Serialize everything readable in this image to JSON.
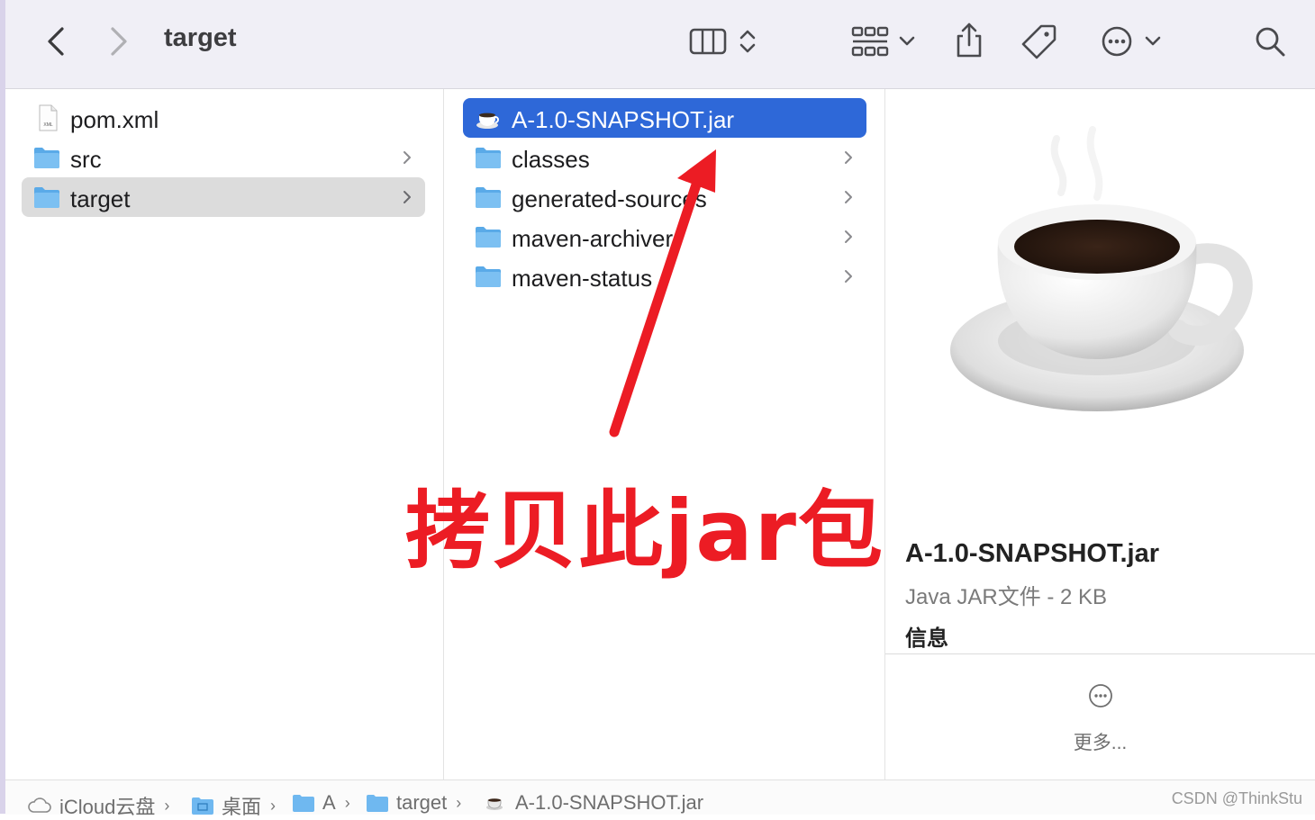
{
  "window": {
    "title": "target"
  },
  "columns": {
    "col1": [
      {
        "label": "pom.xml",
        "icon": "xml-file-icon",
        "folder": false,
        "selected": "none"
      },
      {
        "label": "src",
        "icon": "folder-icon",
        "folder": true,
        "selected": "none"
      },
      {
        "label": "target",
        "icon": "folder-icon",
        "folder": true,
        "selected": "inactive"
      }
    ],
    "col2": [
      {
        "label": "A-1.0-SNAPSHOT.jar",
        "icon": "jar-file-icon",
        "folder": false,
        "selected": "active"
      },
      {
        "label": "classes",
        "icon": "folder-icon",
        "folder": true,
        "selected": "none"
      },
      {
        "label": "generated-sources",
        "icon": "folder-icon",
        "folder": true,
        "selected": "none"
      },
      {
        "label": "maven-archiver",
        "icon": "folder-icon",
        "folder": true,
        "selected": "none"
      },
      {
        "label": "maven-status",
        "icon": "folder-icon",
        "folder": true,
        "selected": "none"
      }
    ]
  },
  "annotation": {
    "text": "拷贝此jar包",
    "color": "#ec1c24"
  },
  "preview": {
    "name": "A-1.0-SNAPSHOT.jar",
    "kind": "Java JAR文件 - 2 KB",
    "info_heading": "信息",
    "more_label": "更多..."
  },
  "pathbar": {
    "crumbs": [
      {
        "label": "iCloud云盘",
        "icon": "cloud-icon"
      },
      {
        "label": "桌面",
        "icon": "desktop-folder-icon"
      },
      {
        "label": "A",
        "icon": "folder-icon"
      },
      {
        "label": "target",
        "icon": "folder-icon"
      },
      {
        "label": "A-1.0-SNAPSHOT.jar",
        "icon": "jar-file-icon"
      }
    ],
    "watermark": "CSDN @ThinkStu"
  },
  "colors": {
    "selection_blue": "#2e68d8",
    "selection_gray": "#dcdcdc",
    "folder_blue": "#6fb8f0"
  }
}
